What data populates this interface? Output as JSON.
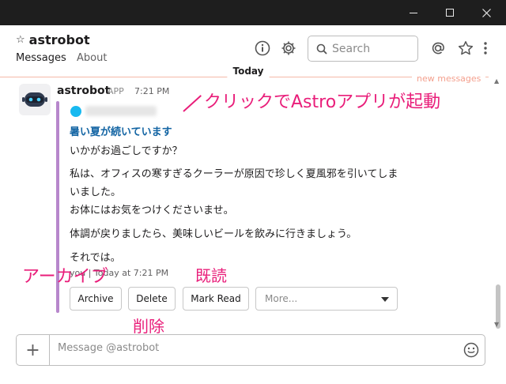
{
  "window": {
    "min_label": "—",
    "max_label": "☐",
    "close_label": "✕"
  },
  "header": {
    "channel_name": "astrobot",
    "star_glyph": "☆",
    "tabs": [
      {
        "label": "Messages"
      },
      {
        "label": "About"
      }
    ],
    "search_placeholder": "Search"
  },
  "timeline": {
    "date_divider": "Today",
    "new_messages_label": "new messages"
  },
  "message": {
    "author": "astrobot",
    "app_badge": "APP",
    "time": "7:21 PM",
    "attachment": {
      "title": "暑い夏が続いています",
      "lines": [
        "いかがお過ごしですか？",
        "私は、オフィスの寒すぎるクーラーが原因で珍しく夏風邪を引いてしま",
        "いました。",
        "お体にはお気をつけくださいませ。",
        "体調が戻りましたら、美味しいビールを飲みに行きましょう。",
        "それでは。"
      ],
      "footer": "you | Today at 7:21 PM"
    },
    "actions": {
      "archive": "Archive",
      "delete": "Delete",
      "mark_read": "Mark Read",
      "more_placeholder": "More..."
    }
  },
  "annotations": {
    "click": "クリックでAstroアプリが起動",
    "archive": "アーカイブ",
    "read": "既読",
    "delete": "削除"
  },
  "composer": {
    "plus": "+",
    "placeholder": "Message @astrobot"
  },
  "colors": {
    "annotation": "#e91e7a",
    "attachment_bar": "#b787cc",
    "link_title": "#1264a3",
    "new_messages": "#f4a08e"
  }
}
